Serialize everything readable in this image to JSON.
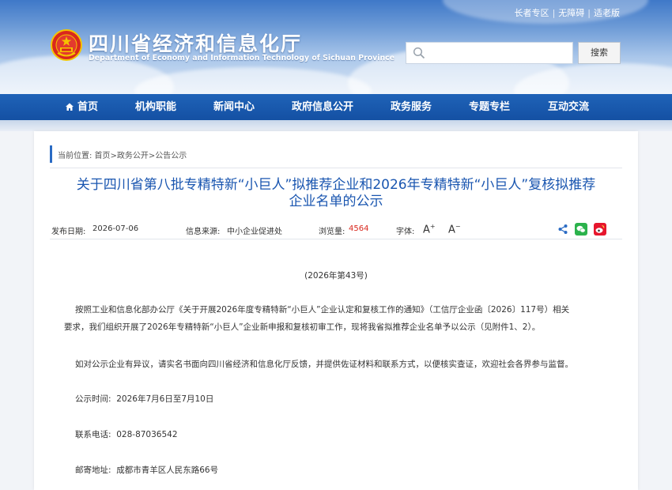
{
  "top_links": [
    "长者专区",
    "无障碍",
    "适老版"
  ],
  "site": {
    "title_cn": "四川省经济和信息化厅",
    "title_en": "Department of Economy and Information Technology of Sichuan Province"
  },
  "search": {
    "placeholder": "",
    "button": "搜索"
  },
  "nav": [
    "首页",
    "机构职能",
    "新闻中心",
    "政府信息公开",
    "政务服务",
    "专题专栏",
    "互动交流"
  ],
  "breadcrumb": "当前位置: 首页>政务公开>公告公示",
  "article": {
    "title_line1": "关于四川省第八批专精特新“小巨人”拟推荐企业和2026年专精特新“小巨人”复核拟推荐",
    "title_line2": "企业名单的公示",
    "publish_label": "发布日期:",
    "publish_date": "2026-07-06",
    "source_label": "信息来源:",
    "source": "中小企业促进处",
    "views_label": "浏览量:",
    "views": "4564",
    "font_label": "字体:",
    "font_up": "A",
    "font_down": "A",
    "doc_no": "(2026年第43号)",
    "para1_line1": "按照工业和信息化部办公厅《关于开展2026年度专精特新“小巨人”企业认定和复核工作的通知》（工信厅企业函〔2026〕117号）相关",
    "para1_line2": "要求，我们组织开展了2026年专精特新“小巨人”企业新申报和复核初审工作，现将我省拟推荐企业名单予以公示（见附件1、2）。",
    "para2": "如对公示企业有异议，请实名书面向四川省经济和信息化厅反馈，并提供佐证材料和联系方式，以便核实查证，欢迎社会各界参与监督。",
    "time_label": "公示时间:",
    "time_value": "2026年7月6日至7月10日",
    "phone_label": "联系电话:",
    "phone_value": "028-87036542",
    "addr_label": "邮寄地址:",
    "addr_value": "成都市青羊区人民东路66号"
  },
  "colors": {
    "nav_bg": "#1a5bb0",
    "title_blue": "#1a56b0",
    "views_red": "#d9281e",
    "wechat": "#2bb24c",
    "weibo": "#e6162d"
  },
  "icons": [
    "emblem-icon",
    "search-icon",
    "home-icon",
    "share-icon",
    "wechat-icon",
    "weibo-icon"
  ]
}
